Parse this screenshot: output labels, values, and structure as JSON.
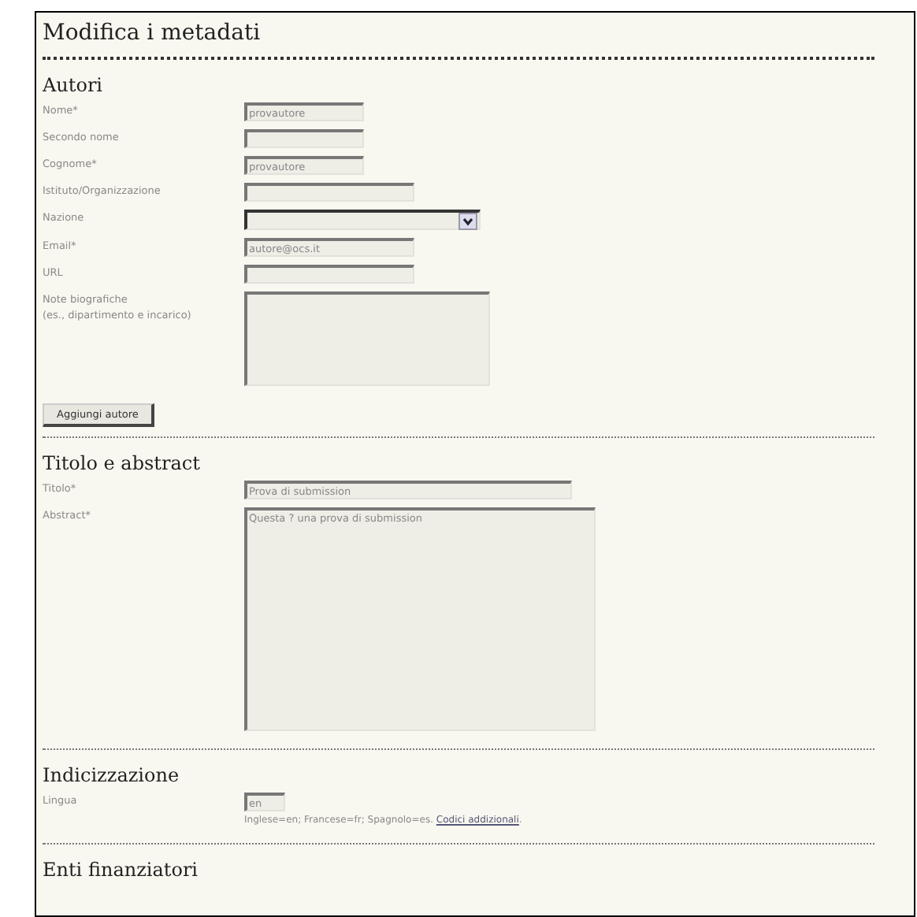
{
  "title": "Modifica i metadati",
  "sections": [
    {
      "heading": "Autori",
      "fields": [
        {
          "kind": "short",
          "label": "Nome*",
          "value": "provautore"
        },
        {
          "kind": "short",
          "label": "Secondo nome"
        },
        {
          "kind": "short",
          "label": "Cognome*",
          "value": "provautore"
        },
        {
          "kind": "medium",
          "label": "Istituto/Organizzazione"
        },
        {
          "kind": "select",
          "label": "Nazione"
        },
        {
          "kind": "medium",
          "label": "Email*",
          "value": "autore@ocs.it"
        },
        {
          "kind": "medium",
          "label": "URL"
        },
        {
          "kind": "note",
          "label": "Note biografiche\n(es., dipartimento e incarico)"
        }
      ],
      "button": "Aggiungi autore"
    },
    {
      "heading": "Titolo e abstract",
      "fields": [
        {
          "kind": "long",
          "label": "Titolo*",
          "value": "Prova di submission"
        },
        {
          "kind": "abstract",
          "label": "Abstract*",
          "value": "Questa ? una prova di submission"
        }
      ]
    },
    {
      "heading": "Indicizzazione",
      "fields": [
        {
          "kind": "tiny",
          "label": "Lingua",
          "value": "en",
          "hint": "Inglese=en; Francese=fr; Spagnolo=es.",
          "hint_link": "Codici addizionali",
          "hint_end": "."
        }
      ]
    },
    {
      "heading": "Enti finanziatori"
    }
  ]
}
